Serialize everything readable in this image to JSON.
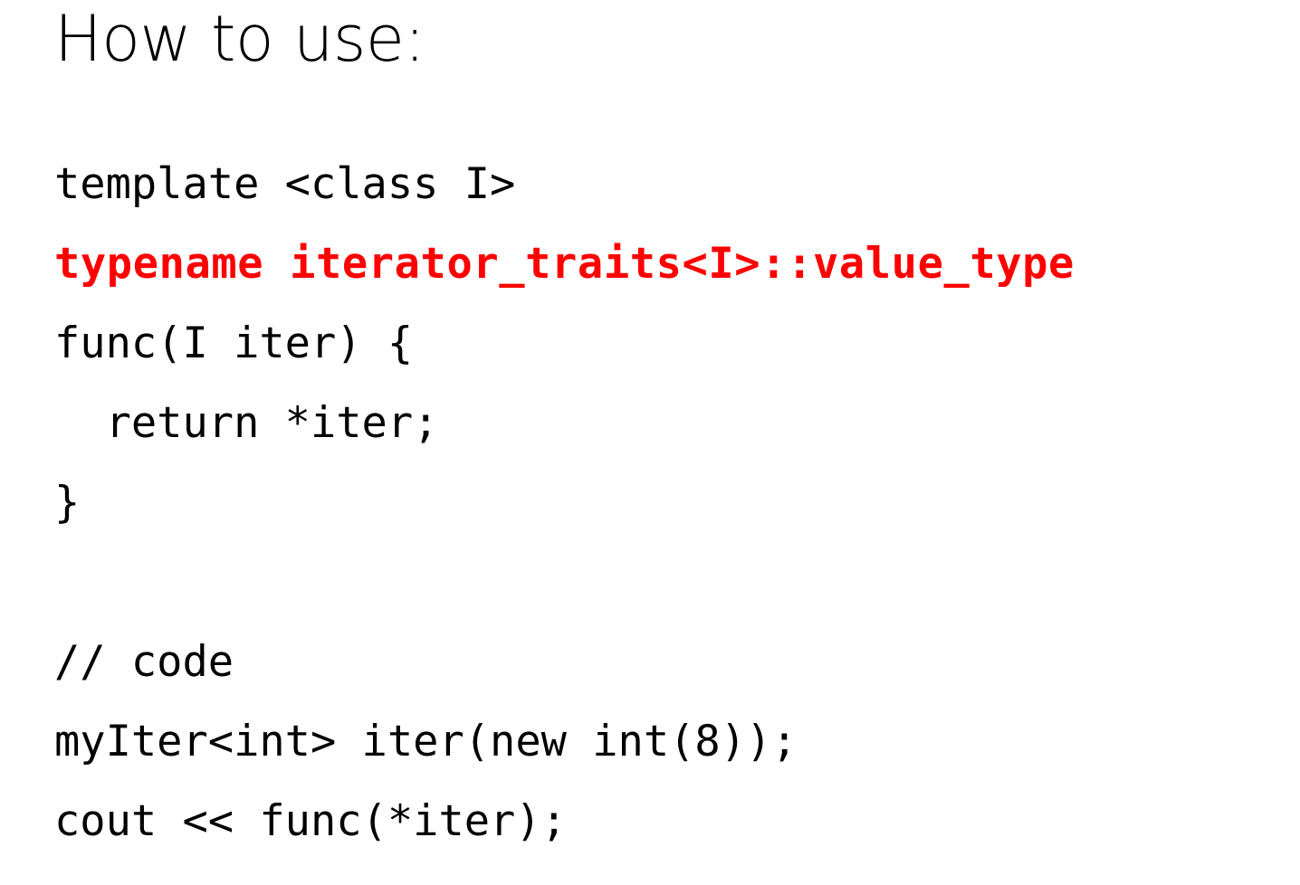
{
  "slide": {
    "title": "How to use:",
    "background_color": "#FFFFFF",
    "text_color": "#000000",
    "highlight_color": "#FF0000",
    "code_lines": [
      {
        "text": "template <class I>",
        "style": "normal"
      },
      {
        "text": "typename iterator_traits<I>::value_type",
        "style": "highlight"
      },
      {
        "text": "func(I iter) {",
        "style": "normal"
      },
      {
        "text": "  return *iter;",
        "style": "normal"
      },
      {
        "text": "}",
        "style": "normal"
      },
      {
        "text": " ",
        "style": "blank"
      },
      {
        "text": "// code",
        "style": "normal"
      },
      {
        "text": "myIter<int> iter(new int(8));",
        "style": "normal"
      },
      {
        "text": "cout << func(*iter);",
        "style": "normal"
      }
    ]
  }
}
